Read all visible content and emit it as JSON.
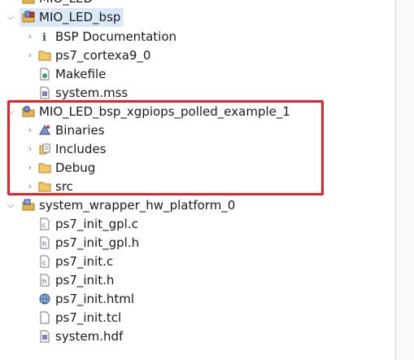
{
  "tree": {
    "items": [
      {
        "label": "MIO_LED"
      },
      {
        "label": "MIO_LED_bsp"
      },
      {
        "label": "BSP Documentation"
      },
      {
        "label": "ps7_cortexa9_0"
      },
      {
        "label": "Makefile"
      },
      {
        "label": "system.mss"
      },
      {
        "label": "MIO_LED_bsp_xgpiops_polled_example_1"
      },
      {
        "label": "Binaries"
      },
      {
        "label": "Includes"
      },
      {
        "label": "Debug"
      },
      {
        "label": "src"
      },
      {
        "label": "system_wrapper_hw_platform_0"
      },
      {
        "label": "ps7_init_gpl.c"
      },
      {
        "label": "ps7_init_gpl.h"
      },
      {
        "label": "ps7_init.c"
      },
      {
        "label": "ps7_init.h"
      },
      {
        "label": "ps7_init.html"
      },
      {
        "label": "ps7_init.tcl"
      },
      {
        "label": "system.hdf"
      }
    ]
  },
  "colors": {
    "highlight_border": "#e0242a",
    "selection": "#dbe8f7",
    "folder": "#e8b24a"
  }
}
